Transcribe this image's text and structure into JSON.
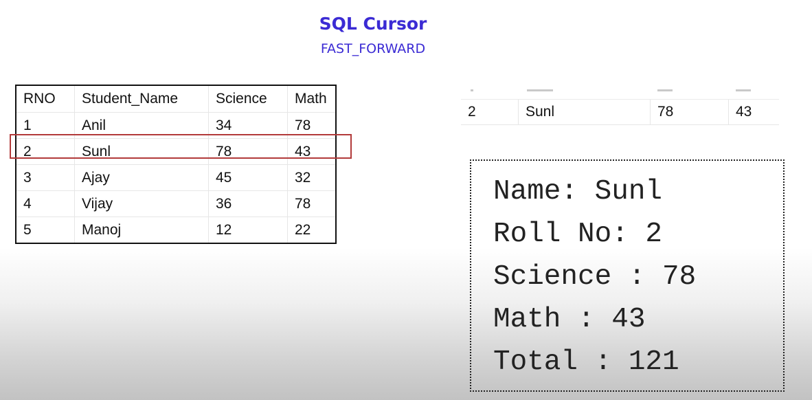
{
  "header": {
    "title": "SQL Cursor",
    "subtitle": "FAST_FORWARD"
  },
  "main_table": {
    "columns": [
      "RNO",
      "Student_Name",
      "Science",
      "Math"
    ],
    "rows": [
      [
        "1",
        "Anil",
        "34",
        "78"
      ],
      [
        "2",
        "Sunl",
        "78",
        "43"
      ],
      [
        "3",
        "Ajay",
        "45",
        "32"
      ],
      [
        "4",
        "Vijay",
        "36",
        "78"
      ],
      [
        "5",
        "Manoj",
        "12",
        "22"
      ]
    ],
    "highlighted_row_rno": "2",
    "highlight_color": "#b23a3a"
  },
  "result_row": [
    "2",
    "Sunl",
    "78",
    "43"
  ],
  "output": {
    "lines": [
      "Name: Sunl",
      "Roll No: 2",
      "Science : 78",
      "Math : 43",
      "Total : 121"
    ]
  },
  "colors": {
    "title": "#3b2bd4"
  }
}
